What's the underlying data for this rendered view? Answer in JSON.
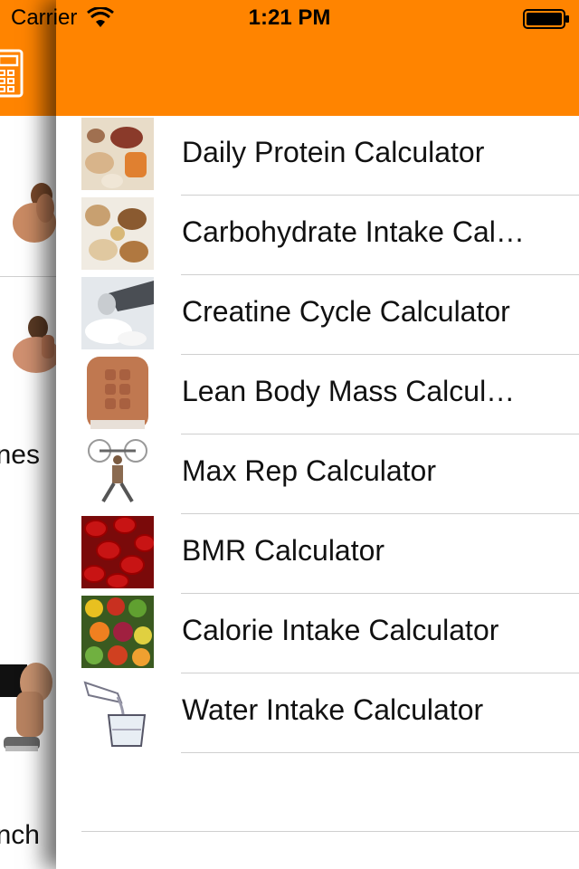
{
  "status_bar": {
    "carrier": "Carrier",
    "time": "1:21 PM",
    "wifi_icon": "wifi-icon",
    "battery_icon": "battery-icon"
  },
  "colors": {
    "accent": "#ff8400",
    "background": "#ffffff",
    "text": "#111111",
    "separator": "#cfcfcf"
  },
  "side_menu": {
    "header_icon": "calculator-icon",
    "partial_labels": [
      "nes",
      "nch"
    ]
  },
  "calculators": [
    {
      "label": "Daily Protein Calculator",
      "icon": "protein-foods-thumbnail"
    },
    {
      "label": "Carbohydrate Intake Cal…",
      "icon": "carbohydrate-foods-thumbnail"
    },
    {
      "label": "Creatine Cycle Calculator",
      "icon": "creatine-powder-thumbnail"
    },
    {
      "label": "Lean Body Mass Calcul…",
      "icon": "abs-torso-thumbnail"
    },
    {
      "label": "Max Rep Calculator",
      "icon": "weightlifter-thumbnail"
    },
    {
      "label": "BMR Calculator",
      "icon": "blood-cells-thumbnail"
    },
    {
      "label": "Calorie Intake Calculator",
      "icon": "fruits-vegetables-thumbnail"
    },
    {
      "label": "Water Intake Calculator",
      "icon": "water-pour-thumbnail"
    }
  ]
}
